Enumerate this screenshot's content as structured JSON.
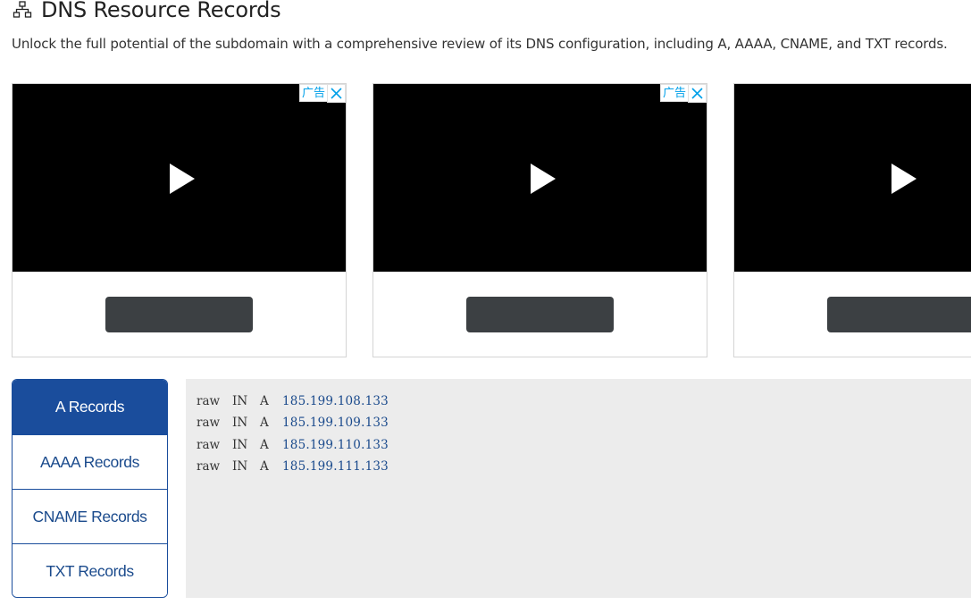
{
  "section": {
    "title": "DNS Resource Records",
    "description": "Unlock the full potential of the subdomain with a comprehensive review of its DNS configuration, including A, AAAA, CNAME, and TXT records.",
    "icon": "sitemap-icon"
  },
  "ads": {
    "label": "广告",
    "close_icon": "close-icon",
    "play_icon": "play-icon"
  },
  "tabs": [
    {
      "label": "A Records",
      "active": true
    },
    {
      "label": "AAAA Records",
      "active": false
    },
    {
      "label": "CNAME Records",
      "active": false
    },
    {
      "label": "TXT Records",
      "active": false
    }
  ],
  "records": [
    {
      "name": "raw",
      "class": "IN",
      "type": "A",
      "value": "185.199.108.133"
    },
    {
      "name": "raw",
      "class": "IN",
      "type": "A",
      "value": "185.199.109.133"
    },
    {
      "name": "raw",
      "class": "IN",
      "type": "A",
      "value": "185.199.110.133"
    },
    {
      "name": "raw",
      "class": "IN",
      "type": "A",
      "value": "185.199.111.133"
    }
  ],
  "colors": {
    "accent": "#1a4d9c",
    "ad_label": "#00a0e9",
    "records_bg": "#ececec"
  }
}
